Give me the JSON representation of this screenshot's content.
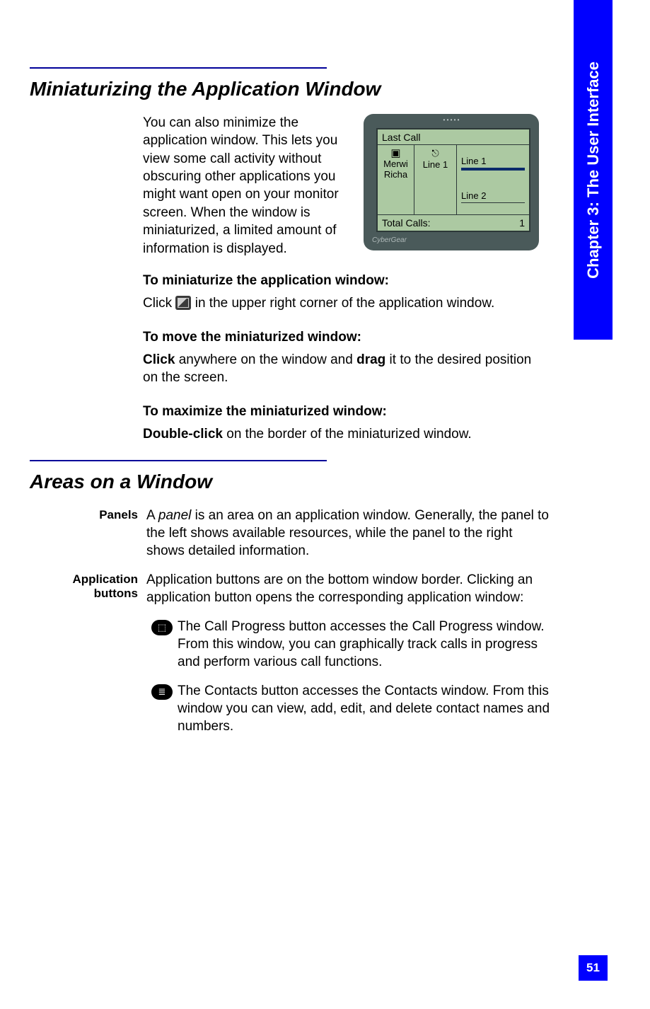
{
  "chapter_tab": "Chapter 3: The User Interface",
  "page_number": "51",
  "section1": {
    "title": "Miniaturizing the Application Window",
    "intro": "You can also minimize the application window. This lets you view some call activity without obscuring other applications you might want open on your monitor screen. When the window is miniaturized, a limited amount of information is displayed.",
    "step1_head": "To miniaturize the application window:",
    "step1_a": "Click ",
    "step1_b": " in the upper right corner of the application window.",
    "step2_head": "To move the miniaturized window:",
    "step2_a": "Click",
    "step2_b": " anywhere on the window and ",
    "step2_c": "drag",
    "step2_d": " it to the desired position on the screen.",
    "step3_head": "To maximize the miniaturized window:",
    "step3_a": "Double-click",
    "step3_b": " on the border of the miniaturized window."
  },
  "figure": {
    "last_call": "Last Call",
    "merwi": "Merwi",
    "richa": "Richa",
    "line1_mid": "Line 1",
    "line1": "Line 1",
    "line2": "Line 2",
    "total_label": "Total Calls:",
    "total_value": "1"
  },
  "section2": {
    "title": "Areas on a Window",
    "panels_label": "Panels",
    "panels_a": "A ",
    "panels_b": "panel",
    "panels_c": " is an area on an application window. Generally, the panel to the left shows available resources, while the panel to the right shows detailed information.",
    "appbtn_label": "Application buttons",
    "appbtn_text": "Application buttons are on the bottom window border. Clicking an application button opens the corresponding application window:",
    "cp_a": "The ",
    "cp_b": "Call Progress",
    "cp_c": " button accesses the Call Progress window. From this window, you can graphically track calls in progress and perform various call functions.",
    "ct_a": "The ",
    "ct_b": "Contacts",
    "ct_c": " button accesses the Contacts window. From this window you can view, add, edit, and delete contact names and numbers."
  }
}
